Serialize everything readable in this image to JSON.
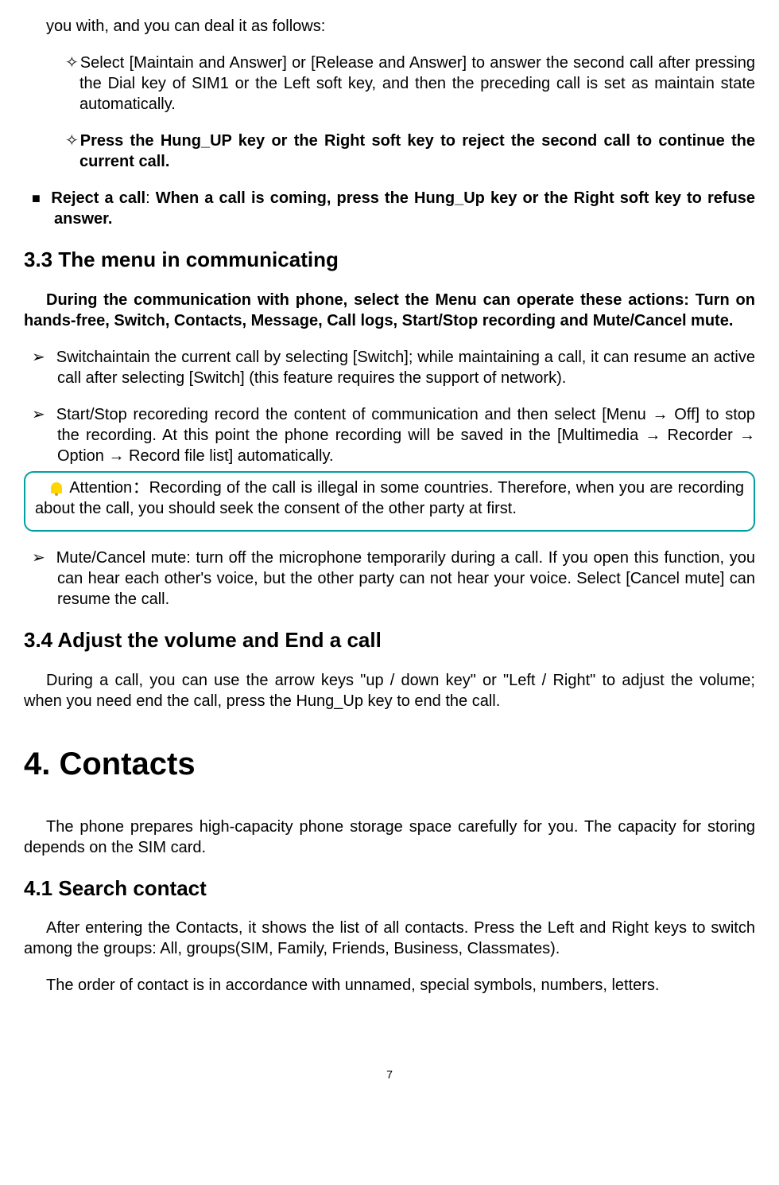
{
  "continued": "you with, and you can deal it as follows:",
  "diamond1": "Select [Maintain and Answer] or [Release and Answer] to answer the second call after pressing the Dial key of SIM1 or the Left soft key, and then the preceding call is set as maintain state automatically.",
  "diamond2": "Press the Hung_UP key or the Right soft key to reject the second call to continue the current call.",
  "square1_label": "Reject a call",
  "square1_rest": ": ",
  "square1_bold": "When a call is coming, press the Hung_Up key or the Right soft key to refuse answer.",
  "h33": "3.3 The menu in communicating",
  "p33": "During the communication with phone, select the Menu can operate these actions: Turn on hands-free, Switch, Contacts, Message, Call logs, Start/Stop recording and Mute/Cancel mute.",
  "arrow1": "Switchaintain the current call by selecting [Switch]; while maintaining a call, it can resume an active call after selecting [Switch] (this feature requires the support of network).",
  "arrow2": "Start/Stop recoreding record the content of communication and then select [Menu → Off] to stop the recording. At this point the phone recording will be saved in the [Multimedia → Recorder → Option → Record file list] automatically.",
  "attention_label": "Attention：",
  "attention_rest": "Recording of the call is illegal in some countries. Therefore, when you are recording about the call, you should seek the consent of the other party at first.",
  "arrow3": "Mute/Cancel mute: turn off the microphone temporarily during a call. If you open this function, you can hear each other's voice, but the other party can not hear your voice. Select [Cancel mute] can resume the call.",
  "h34": "3.4 Adjust the volume and End a call",
  "p34": "During a call, you can use the arrow keys \"up / down key\" or \"Left / Right\" to adjust the volume; when you need end the call, press the Hung_Up key to end the call.",
  "h4": "4. Contacts",
  "p4": "The phone prepares high-capacity phone storage space carefully for you. The capacity for storing depends on the SIM card.",
  "h41": "4.1 Search contact",
  "p41a": "After entering the Contacts, it shows the list of all contacts. Press the Left and Right keys to switch among the groups: All, groups(SIM, Family, Friends, Business, Classmates).",
  "p41b": "The order of contact is in accordance with unnamed, special symbols, numbers, letters.",
  "page_num": "7"
}
